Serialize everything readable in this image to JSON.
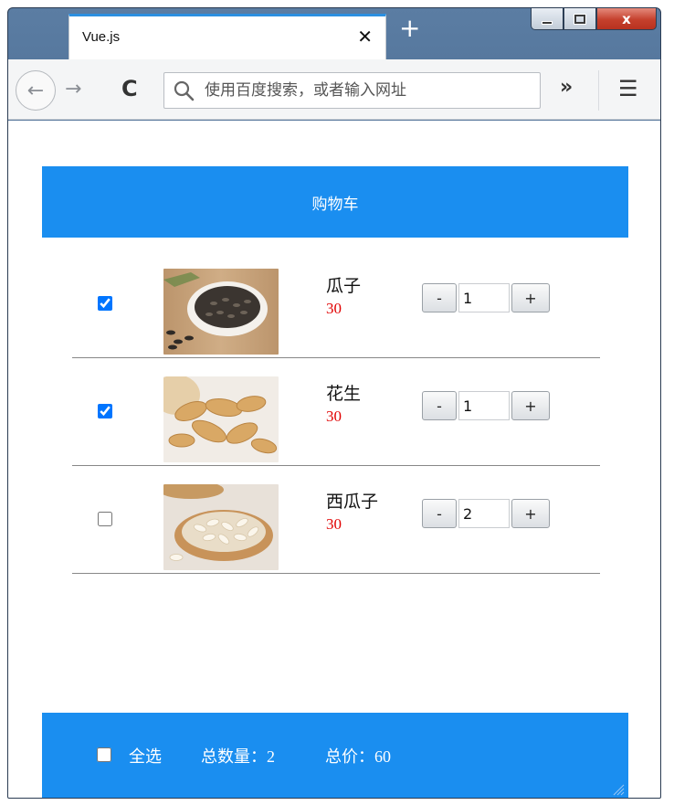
{
  "browser": {
    "tab_title": "Vue.js",
    "tab_close": "✕",
    "new_tab": "+",
    "window_controls": {
      "close": "x"
    },
    "url_placeholder": "使用百度搜索，或者输入网址",
    "overflow": "»",
    "menu": "☰",
    "back": "←",
    "forward": "→",
    "reload": "C"
  },
  "cart": {
    "header": "购物车",
    "items": [
      {
        "name": "瓜子",
        "price": "30",
        "qty": "1",
        "checked": true,
        "image": "sunflower-seeds"
      },
      {
        "name": "花生",
        "price": "30",
        "qty": "1",
        "checked": true,
        "image": "peanuts"
      },
      {
        "name": "西瓜子",
        "price": "30",
        "qty": "2",
        "checked": false,
        "image": "watermelon-seeds"
      }
    ],
    "minus_label": "-",
    "plus_label": "+"
  },
  "footer": {
    "select_all": "全选",
    "select_all_checked": false,
    "count_label": "总数量：",
    "count_value": "2",
    "total_label": "总价：",
    "total_value": "60"
  },
  "colors": {
    "accent": "#1a8ef0",
    "price": "#e10000"
  }
}
